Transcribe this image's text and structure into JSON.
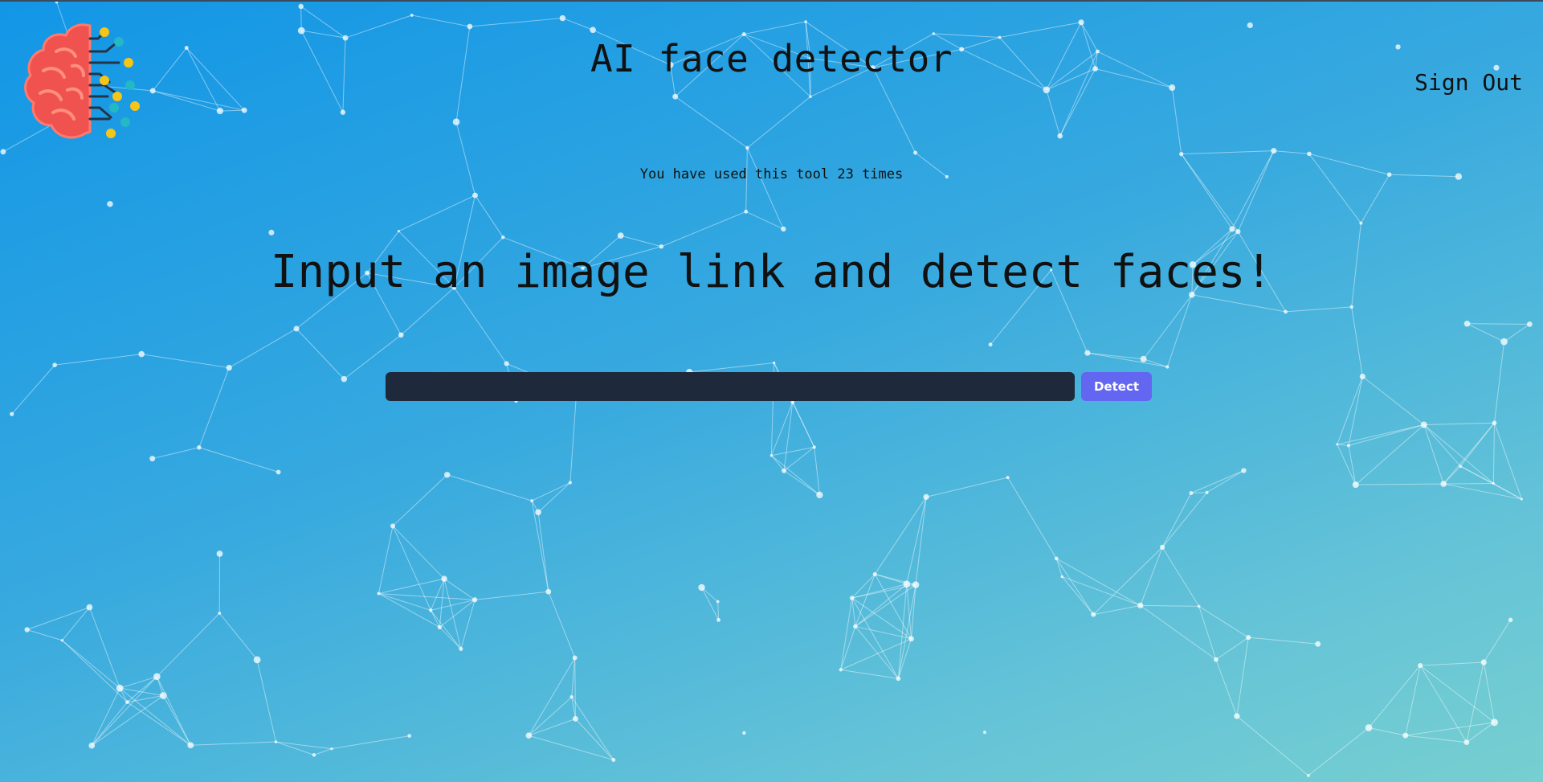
{
  "header": {
    "title": "AI face detector",
    "logo_icon": "brain-circuit-icon",
    "sign_out_label": "Sign Out"
  },
  "main": {
    "usage_text": "You have used this tool 23 times",
    "headline": "Input an image link and detect faces!",
    "url_input": {
      "value": "",
      "placeholder": ""
    },
    "detect_label": "Detect"
  },
  "colors": {
    "background_top": "#1296e6",
    "background_bottom": "#76cfd0",
    "input_background": "#1e293b",
    "detect_button": "#6366f1",
    "network_lines": "#ffffff"
  }
}
